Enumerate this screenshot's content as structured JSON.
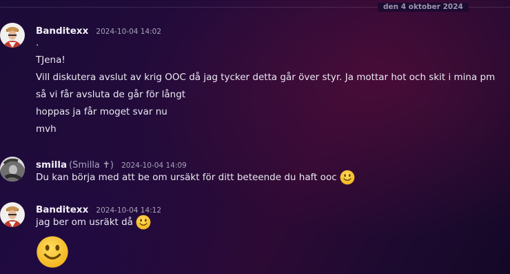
{
  "divider": {
    "date": "den 4 oktober 2024"
  },
  "messages": [
    {
      "author": "Banditexx",
      "nick": "",
      "timestamp": "2024-10-04 14:02",
      "lines": [
        ".",
        "TJena!",
        "Vill diskutera avslut av krig OOC då jag tycker detta går över styr. Ja mottar hot och skit i mina pm",
        "så vi får avsluta de går för långt",
        "hoppas ja får moget svar nu",
        "mvh"
      ]
    },
    {
      "author": "smilla",
      "nick": "(Smilla ✝)",
      "timestamp": "2024-10-04 14:09",
      "lines": [
        "Du kan börja med att be om ursäkt för ditt beteende du haft ooc"
      ],
      "emoji": "slightly-smiling-face"
    },
    {
      "author": "Banditexx",
      "nick": "",
      "timestamp": "2024-10-04 14:12",
      "lines": [
        "jag ber om usräkt då"
      ],
      "emoji": "slightly-smiling-face",
      "big_emoji": "slightly-smiling-face"
    }
  ],
  "colors": {
    "background": "#220b3a",
    "username": "#f2f0f7",
    "timestamp": "#a8a3b8",
    "emoji_yellow": "#f8c53a"
  }
}
